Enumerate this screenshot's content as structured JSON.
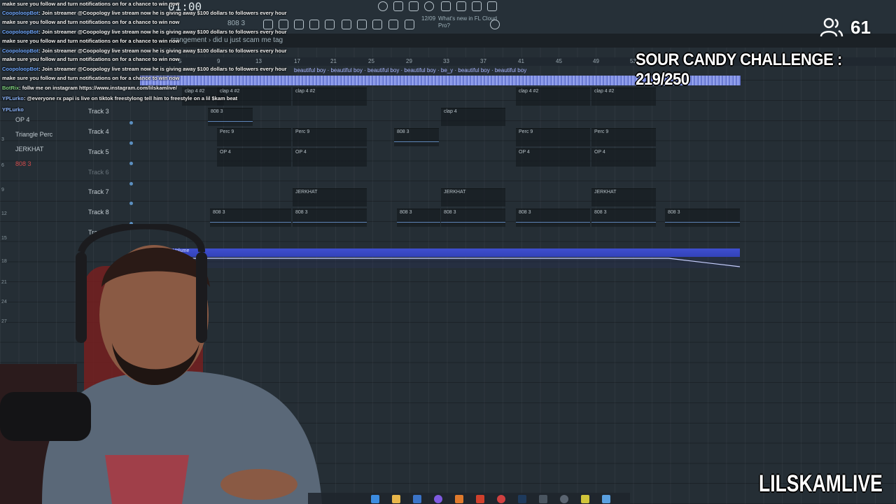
{
  "toolbar": {
    "time": "01:00",
    "pattern": "808 3",
    "news": "What's new in FL Cloud Pro?",
    "news_date": "12/09",
    "breadcrumb": "rrangement › did u just scam me tag"
  },
  "ruler": [
    "5",
    "9",
    "13",
    "17",
    "21",
    "25",
    "29",
    "33",
    "37",
    "41",
    "45",
    "49",
    "53"
  ],
  "wave_label": "beautiful boy · beautiful boy · beautiful boy · beautiful boy · be_y · beautiful boy · beautiful boy",
  "tracks": [
    {
      "label": "Track 3"
    },
    {
      "label": "Track 4"
    },
    {
      "label": "Track 5"
    },
    {
      "label": "Track 6"
    },
    {
      "label": "Track 7"
    },
    {
      "label": "Track 8"
    },
    {
      "label": "Track 9"
    }
  ],
  "clips": {
    "c1": "clap 4 #2",
    "c2": "clap 4 #2",
    "c3": "clap 4 #2",
    "c4": "clap 4 #2",
    "c5": "clap 4 #2",
    "t3a": "808 3",
    "t3b": "clap 4",
    "t4a": "Perc 9",
    "t4b": "Perc 9",
    "t4c": "808 3",
    "t4d": "Perc 9",
    "t4e": "Perc 9",
    "t5a": "OP 4",
    "t5b": "OP 4",
    "t5c": "OP 4",
    "t5d": "OP 4",
    "t7a": "JERKHAT",
    "t7b": "JERKHAT",
    "t7c": "JERKHAT",
    "t8a": "808 3",
    "t8b": "808 3",
    "t8c": "808 3",
    "t8d": "808 3",
    "t8e": "808 3",
    "t8f": "808 3",
    "t8g": "808 3"
  },
  "automation_label": "Volume",
  "rack": [
    "OP 4",
    "Triangle Perc",
    "JERKHAT",
    "808 3"
  ],
  "rownums": [
    "3",
    "6",
    "9",
    "12",
    "15",
    "18",
    "21",
    "24",
    "27"
  ],
  "chat": [
    {
      "user": "",
      "text": "make sure you follow and turn notifications on for a chance to win now"
    },
    {
      "user": "CoopoloopBot",
      "text": ": Join streamer @Coopology live stream now he is giving away $100 dollars to followers every hour"
    },
    {
      "user": "",
      "text": "make sure you follow and turn notifications on for a chance to win now"
    },
    {
      "user": "CoopoloopBot",
      "text": ": Join streamer @Coopology live stream now he is giving away $100 dollars to followers every hour"
    },
    {
      "user": "",
      "text": "make sure you follow and turn notifications on for a chance to win now"
    },
    {
      "user": "CoopoloopBot",
      "text": ": Join streamer @Coopology live stream now he is giving away $100 dollars to followers every hour"
    },
    {
      "user": "",
      "text": "make sure you follow and turn notifications on for a chance to win now"
    },
    {
      "user": "CoopoloopBot",
      "text": ": Join streamer @Coopology live stream now he is giving away $100 dollars to followers every hour"
    },
    {
      "user": "",
      "text": "make sure you follow and turn notifications on for a chance to win now"
    },
    {
      "user": "BotRix",
      "text": ": follw me on instagram https://www.instagram.com/lilskamlive/"
    },
    {
      "user": "YPLurko",
      "text": ": @everyone rx papi is live on tiktok freestylong tell him to freestyle on a lil $kam beat"
    },
    {
      "user": "YPLurko",
      "text": ""
    }
  ],
  "overlay": {
    "viewers": "61",
    "challenge": "SOUR CANDY CHALLENGE : 219/250",
    "brand": "LILSKAMLIVE"
  }
}
